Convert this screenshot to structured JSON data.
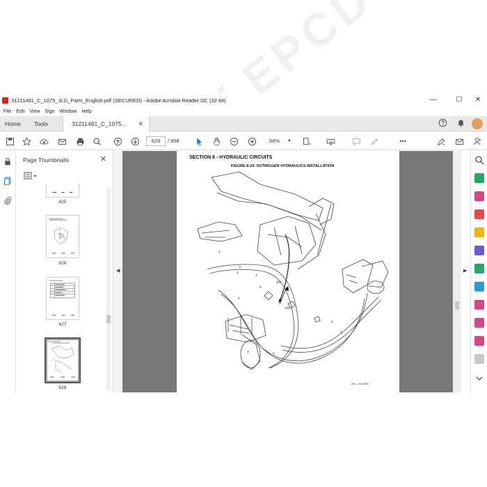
{
  "window": {
    "title": "31211481_C_1075_JLG_Parts_English.pdf (SECURED) - Adobe Acrobat Reader DC (32-bit)",
    "controls": [
      "—",
      "☐",
      "✕"
    ]
  },
  "menu": [
    "File",
    "Edit",
    "View",
    "Sign",
    "Window",
    "Help"
  ],
  "tabs": {
    "home": "Home",
    "tools": "Tools",
    "document": "31211481_C_1075...",
    "close": "✕"
  },
  "toolbar": {
    "current_page": "628",
    "total_pages": "/ 958",
    "zoom": "58%",
    "more": "•••"
  },
  "thumbnails": {
    "header": "Page Thumbnails",
    "close": "✕",
    "items": [
      {
        "page": "625"
      },
      {
        "page": "626"
      },
      {
        "page": "627"
      },
      {
        "page": "628"
      }
    ]
  },
  "document": {
    "section": "SECTION 8 - HYDRAULIC CIRCUITS",
    "figure": "FIGURE 8-24. OUTRIGGER HYDRAULICS INSTALLATION",
    "callouts": [
      "1",
      "2",
      "3",
      "4",
      "5",
      "6",
      "101",
      "102",
      "4",
      "3",
      "3",
      "4"
    ],
    "drawing_code": "ARC_7001458D"
  },
  "watermark": "WWW.EPCDO.COM",
  "colors": {
    "accent": "#1a73e8",
    "app_red": "#d7231f",
    "viewer_bg": "#777777"
  }
}
